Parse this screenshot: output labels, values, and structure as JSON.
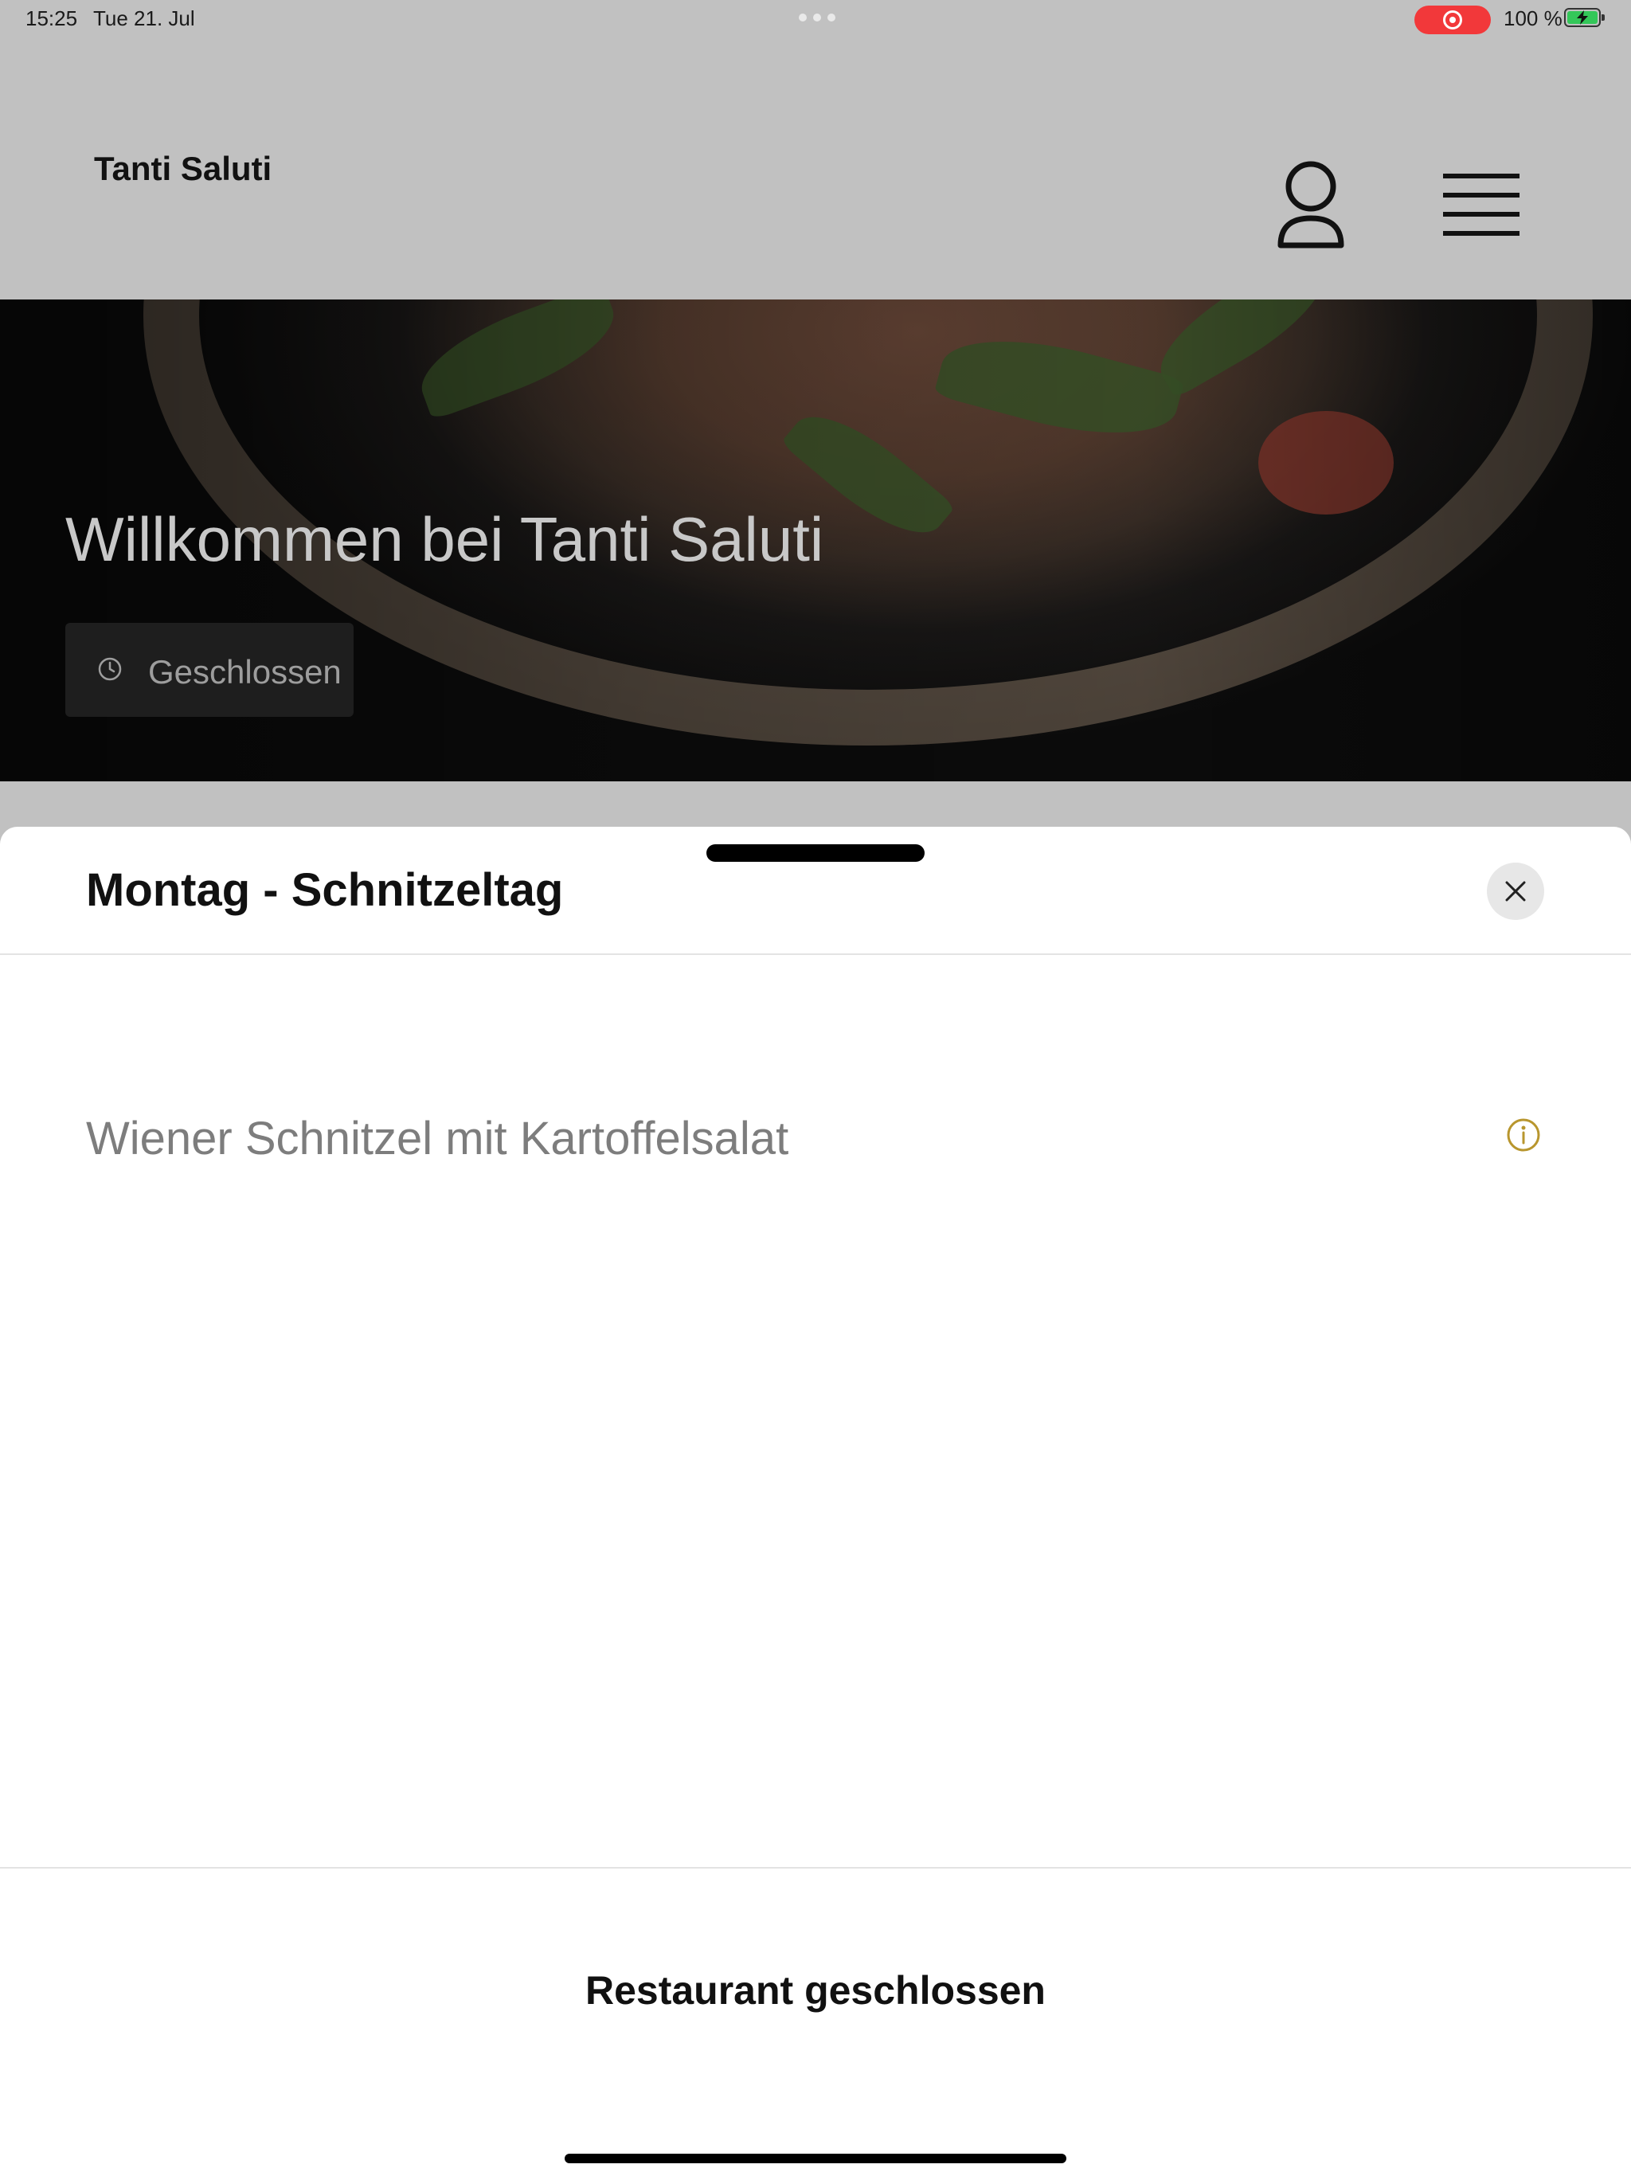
{
  "status_bar": {
    "time": "15:25",
    "date": "Tue 21. Jul",
    "battery": "100 %",
    "recording_color": "#f2383a",
    "battery_color": "#34c759"
  },
  "header": {
    "brand": "Tanti Saluti",
    "user_icon": "user-icon",
    "menu_icon": "hamburger-menu-icon"
  },
  "hero": {
    "title": "Willkommen bei Tanti Saluti",
    "badge_icon": "clock-icon",
    "badge_label": "Geschlossen"
  },
  "sheet": {
    "title": "Montag - Schnitzeltag",
    "close_icon": "close-icon",
    "items": [
      {
        "name": "Wiener Schnitzel mit Kartoffelsalat",
        "icon": "info-icon",
        "icon_color": "#b8962e"
      }
    ],
    "footer_status": "Restaurant geschlossen"
  }
}
